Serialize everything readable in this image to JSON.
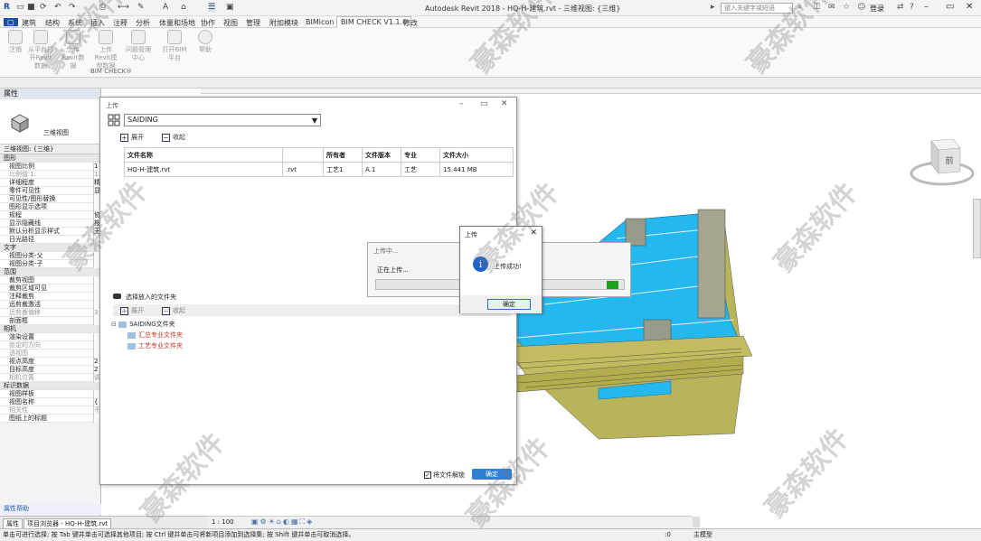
{
  "titlebar": {
    "app_title": "Autodesk Revit 2018 -   HQ-H-建筑.rvt - 三维视图: {三维}",
    "search_placeholder": "键入关键字或短语",
    "login": "登录"
  },
  "ribbon": {
    "tabs": [
      "建筑",
      "结构",
      "系统",
      "插入",
      "注释",
      "分析",
      "体量和场地",
      "协作",
      "视图",
      "管理",
      "附加模块",
      "BIMicon",
      "BIM CHECK V1.1.0",
      "修改"
    ],
    "active_tab": "BIM CHECK V1.1.0",
    "buttons": [
      {
        "label": "注销"
      },
      {
        "label": "从平台打开Revit数据"
      },
      {
        "label": "上传Revit数据"
      },
      {
        "label": "上传Revit模型数据"
      },
      {
        "label": "问题管理中心"
      },
      {
        "label": "打开BIM平台"
      },
      {
        "label": "帮助"
      }
    ],
    "group_label": "BIM CHECK®"
  },
  "properties": {
    "header": "属性",
    "type_label": "三维视图",
    "filter": "三维视图: {三维}",
    "rows": [
      {
        "label": "图形",
        "group": true
      },
      {
        "label": "视图比例",
        "value": "1"
      },
      {
        "label": "比例值 1:",
        "value": "1",
        "dim": true
      },
      {
        "label": "详细程度",
        "value": "精"
      },
      {
        "label": "零件可见性",
        "value": "显"
      },
      {
        "label": "可见性/图形替换",
        "value": ""
      },
      {
        "label": "图形显示选项",
        "value": ""
      },
      {
        "label": "规程",
        "value": "协"
      },
      {
        "label": "显示隐藏线",
        "value": "按"
      },
      {
        "label": "默认分析显示样式",
        "value": "无"
      },
      {
        "label": "日光路径",
        "value": ""
      },
      {
        "label": "文字",
        "group": true
      },
      {
        "label": "视图分类-父",
        "value": ""
      },
      {
        "label": "视图分类-子",
        "value": ""
      },
      {
        "label": "范围",
        "group": true
      },
      {
        "label": "裁剪视图",
        "value": ""
      },
      {
        "label": "裁剪区域可见",
        "value": ""
      },
      {
        "label": "注释裁剪",
        "value": ""
      },
      {
        "label": "远剪裁激活",
        "value": ""
      },
      {
        "label": "远剪裁偏移",
        "value": "3",
        "dim": true
      },
      {
        "label": "剖面框",
        "value": ""
      },
      {
        "label": "相机",
        "group": true
      },
      {
        "label": "渲染设置",
        "value": ""
      },
      {
        "label": "锁定的方向",
        "value": "",
        "dim": true
      },
      {
        "label": "透视图",
        "value": "",
        "dim": true
      },
      {
        "label": "视点高度",
        "value": "2"
      },
      {
        "label": "目标高度",
        "value": "2"
      },
      {
        "label": "相机位置",
        "value": "调",
        "dim": true
      },
      {
        "label": "标识数据",
        "group": true
      },
      {
        "label": "视图样板",
        "value": ""
      },
      {
        "label": "视图名称",
        "value": "{"
      },
      {
        "label": "相关性",
        "value": "不",
        "dim": true
      },
      {
        "label": "图纸上的标题",
        "value": ""
      }
    ],
    "help": "属性帮助"
  },
  "bottom_tabs": [
    "属性",
    "项目浏览器 - HQ-H-建筑.rvt"
  ],
  "view_bar": {
    "scale": "1 : 100"
  },
  "status": {
    "text": "单击可进行选择; 按 Tab 键并单击可选择其他项目; 按 Ctrl 键并单击可将新项目添加到选择集; 按 Shift 键并单击可取消选择。",
    "zero": ":0",
    "model": "主模型"
  },
  "upload_dialog": {
    "title": "上传",
    "project": "SAIDING",
    "expand": "展开",
    "collapse": "收起",
    "columns": [
      "文件名称",
      "",
      "所有者",
      "文件版本",
      "专业",
      "文件大小"
    ],
    "rows": [
      [
        "HQ-H-建筑.rvt",
        ".rvt",
        "工艺1",
        "A.1",
        "工艺",
        "15.441 MB"
      ]
    ],
    "select_folder": "选择放入的文件夹",
    "tree": {
      "root": "SAIDING文件夹",
      "children": [
        "汇总专业文件夹",
        "工艺专业文件夹"
      ]
    },
    "delete_label": "将文件解锁",
    "confirm": "确定"
  },
  "progress_dialog": {
    "title": "上传中...",
    "text": "正在上传...",
    "progress": 0.95
  },
  "success_dialog": {
    "title": "上传",
    "message": "上传成功!",
    "ok": "确定"
  },
  "viewcube": {
    "face": "前"
  },
  "watermark": "豪森软件",
  "colors": {
    "roof": "#25b8ee",
    "wall": "#b8b45a",
    "accent": "#2f7fd6"
  }
}
